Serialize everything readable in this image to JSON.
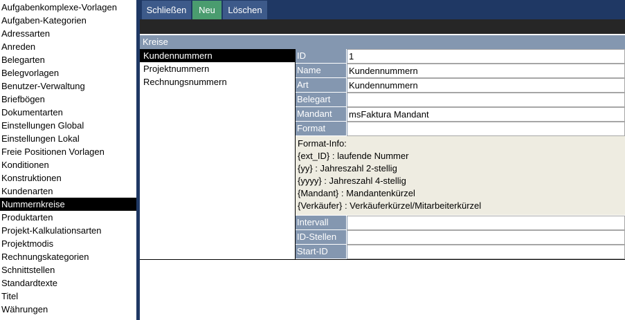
{
  "sidebar": {
    "items": [
      {
        "label": "Aufgabenkomplexe-Vorlagen",
        "selected": false
      },
      {
        "label": "Aufgaben-Kategorien",
        "selected": false
      },
      {
        "label": "Adressarten",
        "selected": false
      },
      {
        "label": "Anreden",
        "selected": false
      },
      {
        "label": "Belegarten",
        "selected": false
      },
      {
        "label": "Belegvorlagen",
        "selected": false
      },
      {
        "label": "Benutzer-Verwaltung",
        "selected": false
      },
      {
        "label": "Briefbögen",
        "selected": false
      },
      {
        "label": "Dokumentarten",
        "selected": false
      },
      {
        "label": "Einstellungen Global",
        "selected": false
      },
      {
        "label": "Einstellungen Lokal",
        "selected": false
      },
      {
        "label": "Freie Positionen Vorlagen",
        "selected": false
      },
      {
        "label": "Konditionen",
        "selected": false
      },
      {
        "label": "Konstruktionen",
        "selected": false
      },
      {
        "label": "Kundenarten",
        "selected": false
      },
      {
        "label": "Nummernkreise",
        "selected": true
      },
      {
        "label": "Produktarten",
        "selected": false
      },
      {
        "label": "Projekt-Kalkulationsarten",
        "selected": false
      },
      {
        "label": "Projektmodis",
        "selected": false
      },
      {
        "label": "Rechnungskategorien",
        "selected": false
      },
      {
        "label": "Schnittstellen",
        "selected": false
      },
      {
        "label": "Standardtexte",
        "selected": false
      },
      {
        "label": "Titel",
        "selected": false
      },
      {
        "label": "Währungen",
        "selected": false
      }
    ]
  },
  "toolbar": {
    "close_label": "Schließen",
    "new_label": "Neu",
    "delete_label": "Löschen"
  },
  "section": {
    "title": "Kreise"
  },
  "kreise": {
    "items": [
      {
        "label": "Kundennummern",
        "selected": true
      },
      {
        "label": "Projektnummern",
        "selected": false
      },
      {
        "label": "Rechnungsnummern",
        "selected": false
      }
    ]
  },
  "detail": {
    "id": {
      "label": "ID",
      "value": "1"
    },
    "name": {
      "label": "Name",
      "value": "Kundennummern"
    },
    "art": {
      "label": "Art",
      "value": "Kundennummern"
    },
    "belegart": {
      "label": "Belegart",
      "value": ""
    },
    "mandant": {
      "label": "Mandant",
      "value": "msFaktura Mandant"
    },
    "format": {
      "label": "Format",
      "value": ""
    },
    "format_info": {
      "title": "Format-Info:",
      "lines": [
        "{ext_ID} : laufende Nummer",
        "{yy} : Jahreszahl 2-stellig",
        "{yyyy} : Jahreszahl 4-stellig",
        "{Mandant} : Mandantenkürzel",
        "{Verkäufer} : Verkäuferkürzel/Mitarbeiterkürzel"
      ]
    },
    "intervall": {
      "label": "Intervall",
      "value": ""
    },
    "id_stellen": {
      "label": "ID-Stellen",
      "value": ""
    },
    "start_id": {
      "label": "Start-ID",
      "value": ""
    }
  },
  "colors": {
    "navy": "#1f3864",
    "button_blue": "#3d5a8a",
    "button_green": "#4a9c6f",
    "label_blue": "#8497b0",
    "info_bg": "#eeece1"
  }
}
